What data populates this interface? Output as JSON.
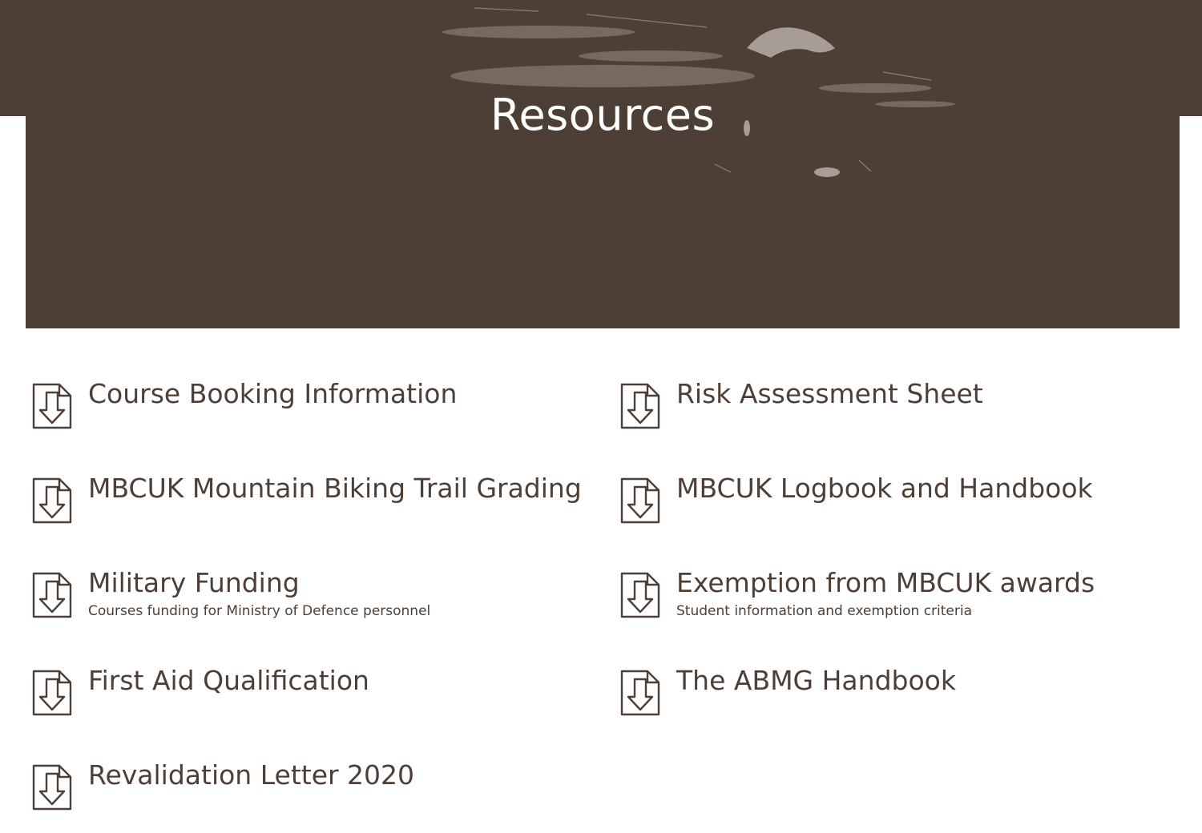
{
  "hero": {
    "title": "Resources"
  },
  "resources": {
    "left_column": [
      {
        "title": "Course Booking Information",
        "subtitle": "",
        "icon": "file-download-icon"
      },
      {
        "title": "MBCUK Mountain Biking Trail Grading",
        "subtitle": "",
        "icon": "file-download-icon"
      },
      {
        "title": "Military Funding",
        "subtitle": "Courses funding for Ministry of Defence personnel",
        "icon": "file-download-icon"
      },
      {
        "title": "First Aid Qualification",
        "subtitle": "",
        "icon": "file-download-icon"
      },
      {
        "title": "Revalidation Letter 2020",
        "subtitle": "",
        "icon": "file-download-icon"
      }
    ],
    "right_column": [
      {
        "title": "Risk Assessment Sheet",
        "subtitle": "",
        "icon": "file-download-icon"
      },
      {
        "title": "MBCUK Logbook and Handbook",
        "subtitle": "",
        "icon": "file-download-icon"
      },
      {
        "title": "Exemption from MBCUK awards",
        "subtitle": "Student information and exemption criteria",
        "icon": "file-download-icon"
      },
      {
        "title": "The ABMG Handbook",
        "subtitle": "",
        "icon": "file-download-icon"
      }
    ]
  },
  "colors": {
    "brand_brown": "#4d3f35",
    "background": "#ffffff",
    "hero_text": "#ffffff"
  }
}
